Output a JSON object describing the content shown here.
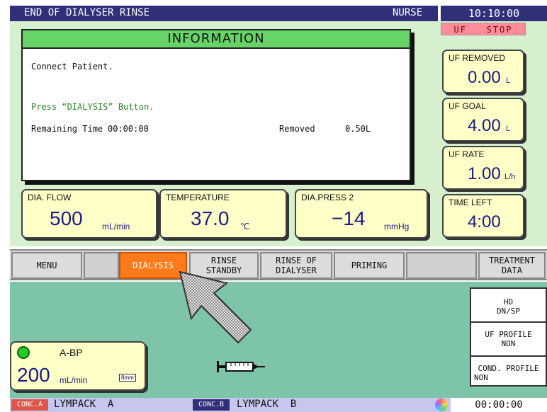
{
  "header": {
    "title": "END OF DIALYSER RINSE",
    "mode": "NURSE",
    "clock": "10:10:00"
  },
  "info_panel": {
    "heading": "INFORMATION",
    "line1": "Connect Patient.",
    "line2": "Press “DIALYSIS” Button.",
    "remaining_label": "Remaining Time",
    "remaining_value": "00:00:00",
    "removed_label": "Removed",
    "removed_value": "0.50L"
  },
  "uf_status": "UF   STOP",
  "uf_removed": {
    "label": "UF REMOVED",
    "value": "0.00",
    "unit": "L"
  },
  "uf_goal": {
    "label": "UF GOAL",
    "value": "4.00",
    "unit": "L"
  },
  "uf_rate": {
    "label": "UF RATE",
    "value": "1.00",
    "unit": "L/h"
  },
  "time_left": {
    "label": "TIME LEFT",
    "value": "4:00"
  },
  "dia_flow": {
    "label": "DIA. FLOW",
    "value": "500",
    "unit": "mL/min"
  },
  "temperature": {
    "label": "TEMPERATURE",
    "value": "37.0",
    "unit": "℃"
  },
  "dia_press": {
    "label": "DIA.PRESS 2",
    "value": "−14",
    "unit": "mmHg"
  },
  "buttons": {
    "menu": "MENU",
    "dialysis": "DIALYSIS",
    "rinse_standby": "RINSE\nSTANDBY",
    "rinse_of_dialyser": "RINSE OF\nDIALYSER",
    "priming": "PRIMING",
    "treatment_data": "TREATMENT\nDATA"
  },
  "right_panel": {
    "mode_line1": "HD",
    "mode_line2": "DN/SP",
    "uf_profile_label": "UF PROFILE",
    "uf_profile_value": "NON",
    "cond_profile_label": "COND. PROFILE",
    "cond_profile_value": "NON"
  },
  "blood_pump": {
    "label": "A-BP",
    "value": "200",
    "unit": "mL/min",
    "tube_size": "8mm"
  },
  "footer": {
    "conc_a_tag": "CONC.A",
    "conc_a_name": "LYMPACK  A",
    "conc_b_tag": "CONC.B",
    "conc_b_name": "LYMPACK  B",
    "elapsed": "00:00:00"
  },
  "colors": {
    "header_bg": "#2f2f7a",
    "active_button": "#ff7a1a",
    "info_head": "#66d466",
    "message_green": "#2a8a2a",
    "status_led": "#22cc22"
  },
  "icons": [
    "syringe-icon",
    "pointer-arrow-icon",
    "status-led-icon",
    "color-wheel-icon"
  ]
}
